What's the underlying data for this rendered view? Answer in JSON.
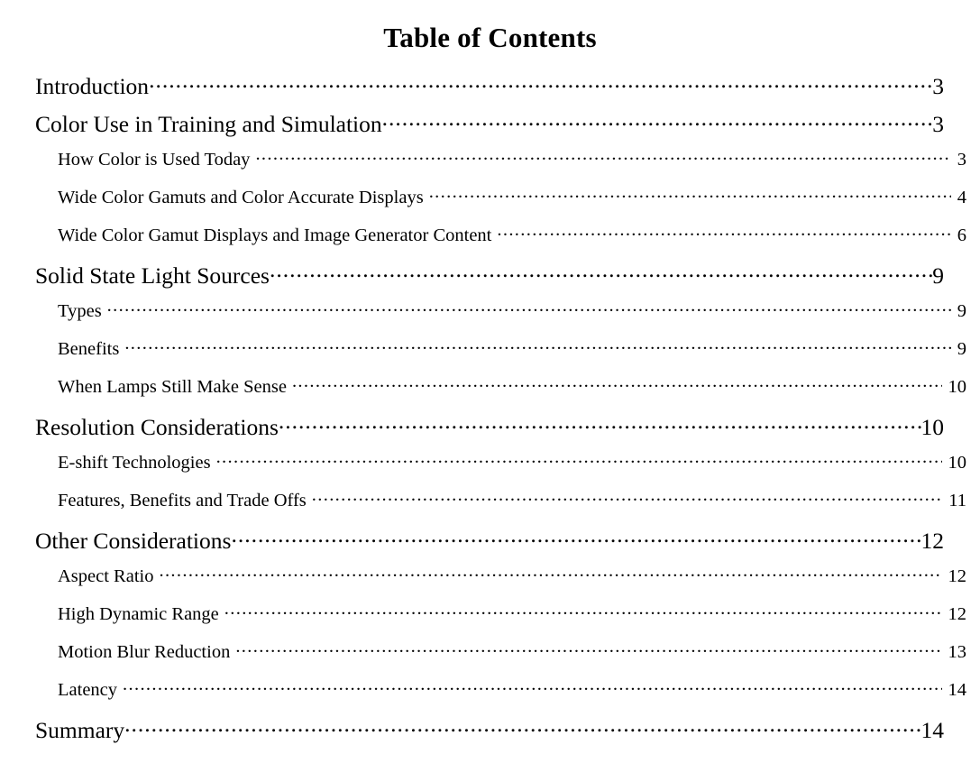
{
  "document": {
    "title": "Table of Contents",
    "background_color": "#ffffff",
    "text_color": "#000000"
  },
  "toc": {
    "entries": [
      {
        "label": "Introduction",
        "page": "3",
        "level": 1
      },
      {
        "label": "Color Use in Training and Simulation",
        "page": "3",
        "level": 1
      },
      {
        "label": "How Color is Used Today",
        "page": "3",
        "level": 2
      },
      {
        "label": "Wide Color Gamuts and Color Accurate Displays",
        "page": "4",
        "level": 2
      },
      {
        "label": "Wide Color Gamut Displays and Image Generator Content",
        "page": "6",
        "level": 2
      },
      {
        "label": "Solid State Light Sources",
        "page": "9",
        "level": 1
      },
      {
        "label": "Types",
        "page": "9",
        "level": 2
      },
      {
        "label": "Benefits",
        "page": "9",
        "level": 2
      },
      {
        "label": "When Lamps Still Make Sense",
        "page": "10",
        "level": 2
      },
      {
        "label": "Resolution Considerations",
        "page": "10",
        "level": 1
      },
      {
        "label": "E-shift Technologies",
        "page": "10",
        "level": 2
      },
      {
        "label": "Features, Benefits and Trade Offs",
        "page": "11",
        "level": 2
      },
      {
        "label": "Other Considerations",
        "page": "12",
        "level": 1
      },
      {
        "label": "Aspect Ratio",
        "page": "12",
        "level": 2
      },
      {
        "label": "High Dynamic Range",
        "page": "12",
        "level": 2
      },
      {
        "label": "Motion Blur Reduction",
        "page": "13",
        "level": 2
      },
      {
        "label": "Latency",
        "page": "14",
        "level": 2
      },
      {
        "label": "Summary",
        "page": "14",
        "level": 1
      }
    ]
  }
}
